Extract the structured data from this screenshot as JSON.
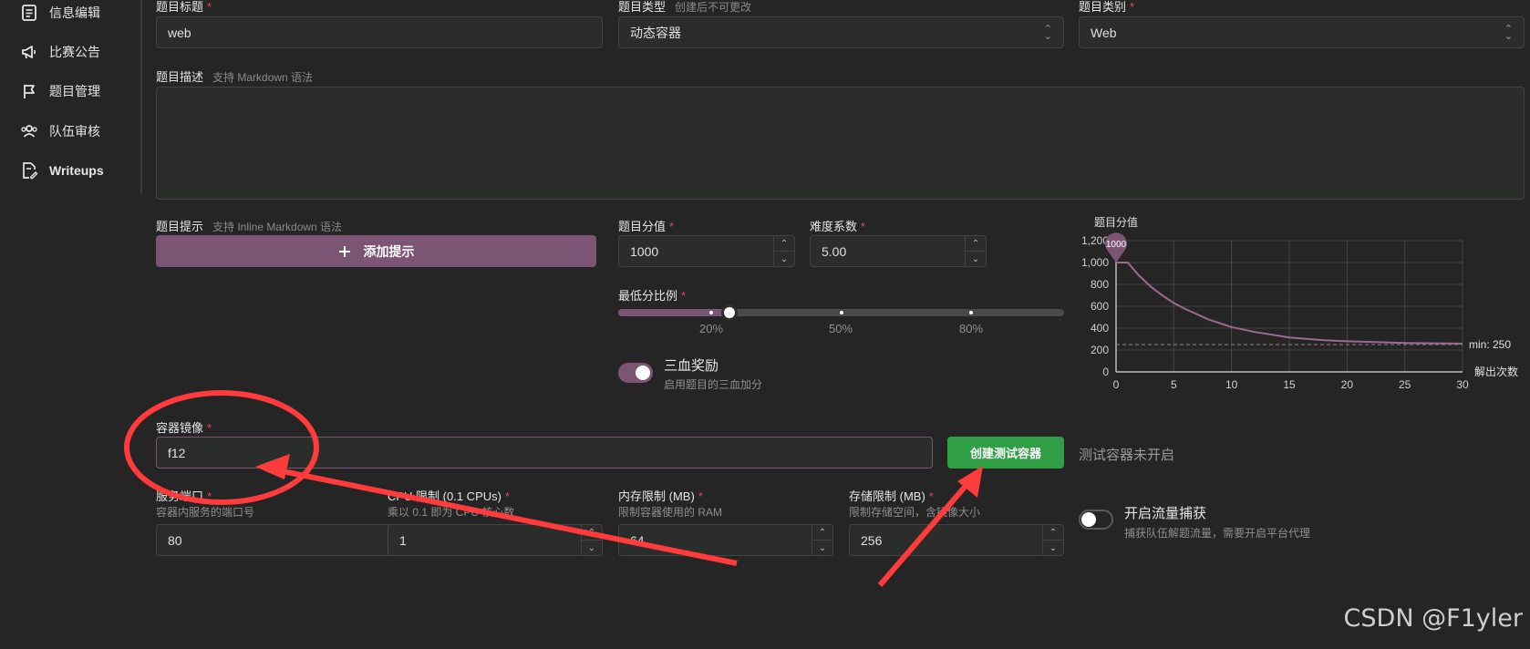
{
  "sidebar": {
    "items": [
      {
        "label": "信息编辑",
        "icon": "document-icon"
      },
      {
        "label": "比赛公告",
        "icon": "megaphone-icon"
      },
      {
        "label": "题目管理",
        "icon": "flag-icon"
      },
      {
        "label": "队伍审核",
        "icon": "users-icon"
      },
      {
        "label": "Writeups",
        "icon": "file-edit-icon"
      }
    ]
  },
  "form": {
    "title": {
      "label": "题目标题",
      "value": "web"
    },
    "type": {
      "label": "题目类型",
      "hint": "创建后不可更改",
      "value": "动态容器"
    },
    "category": {
      "label": "题目类别",
      "value": "Web"
    },
    "description": {
      "label": "题目描述",
      "hint": "支持 Markdown 语法",
      "value": ""
    },
    "hints": {
      "label": "题目提示",
      "hint": "支持 Inline Markdown 语法",
      "add_button": "添加提示"
    },
    "score": {
      "label": "题目分值",
      "value": "1000"
    },
    "difficulty": {
      "label": "难度系数",
      "value": "5.00"
    },
    "min_ratio": {
      "label": "最低分比例",
      "value_fraction": 0.25,
      "marks": [
        "20%",
        "50%",
        "80%"
      ]
    },
    "blood": {
      "label": "三血奖励",
      "desc": "启用题目的三血加分",
      "enabled": true
    },
    "image": {
      "label": "容器镜像",
      "value": "f12"
    },
    "create_button": "创建测试容器",
    "container_status": "测试容器未开启",
    "port": {
      "label": "服务端口",
      "desc": "容器内服务的端口号",
      "value": "80"
    },
    "cpu": {
      "label": "CPU 限制 (0.1 CPUs)",
      "desc": "乘以 0.1 即为 CPU 核心数",
      "value": "1"
    },
    "memory": {
      "label": "内存限制 (MB)",
      "desc": "限制容器使用的 RAM",
      "value": "64"
    },
    "storage": {
      "label": "存储限制 (MB)",
      "desc": "限制存储空间，含镜像大小",
      "value": "256"
    },
    "traffic": {
      "label": "开启流量捕获",
      "desc": "捕获队伍解题流量，需要开启平台代理",
      "enabled": false
    }
  },
  "colors": {
    "accent": "#7c5474",
    "success": "#2f9e44",
    "required": "#e5484d",
    "annotation": "#ff3b3b"
  },
  "chart_data": {
    "type": "line",
    "title": "题目分值",
    "xlabel": "解出次数",
    "ylabel": "",
    "xlim": [
      0,
      30
    ],
    "ylim": [
      0,
      1200
    ],
    "xticks": [
      0,
      5,
      10,
      15,
      20,
      25,
      30
    ],
    "yticks": [
      0,
      200,
      400,
      600,
      800,
      "1,000",
      "1,200"
    ],
    "x": [
      0,
      1,
      2,
      3,
      4,
      5,
      6,
      8,
      10,
      12,
      15,
      18,
      20,
      25,
      30
    ],
    "y": [
      1000,
      1000,
      880,
      780,
      700,
      630,
      575,
      480,
      410,
      365,
      315,
      290,
      280,
      265,
      258
    ],
    "peak_label": "1000",
    "min_value": 250,
    "min_label": "min: 250",
    "grid": true
  },
  "watermark": "CSDN @F1yler"
}
